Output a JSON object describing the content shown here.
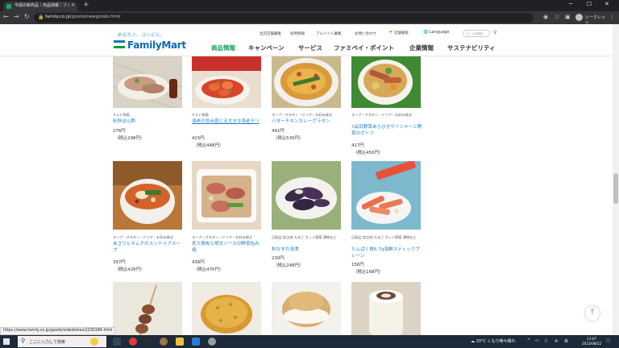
{
  "browser": {
    "tab_title": "今週の新商品｜商品情報｜ファミ",
    "url_host": "family.co.jp",
    "url_path": "/goods/newgoods.html",
    "incognito_label": "シークレット"
  },
  "header": {
    "tagline": "あなたと、コンビに、",
    "logo_text": "FamilyMart",
    "util_links": [
      "出店店舗募集",
      "採用情報",
      "アルバイト募集",
      "お問い合わせ"
    ],
    "store_search": "店舗検索",
    "language": "Language",
    "search_placeholder": "サイト内検索",
    "gnav": [
      "商品情報",
      "キャンペーン",
      "サービス",
      "ファミペイ・ポイント",
      "企業情報",
      "サステナビリティ"
    ]
  },
  "products": [
    {
      "category": "チルド惣菜",
      "name": "砂肝ぽん酢",
      "price": "276円",
      "tax_price": "（税込298円）"
    },
    {
      "category": "チルド惣菜",
      "name": "海老の旨み感じる大きな海老チリ",
      "price": "415円",
      "tax_price": "（税込448円）"
    },
    {
      "category": "スープ・グラタン・ドリア・お好み焼き",
      "name": "バターチキンカレーグラタン",
      "price": "491円",
      "tax_price": "（税込530円）"
    },
    {
      "category": "スープ・グラタン・ドリア・お好み焼き",
      "name": "7品目野菜あらびきウインナーと野菜のポトフ",
      "price": "417円",
      "tax_price": "（税込450円）"
    },
    {
      "category": "スープ・グラタン・ドリア・お好み焼き",
      "name": "あさりとキムチのスンドゥブスープ",
      "price": "397円",
      "tax_price": "（税込428円）"
    },
    {
      "category": "スープ・グラタン・ドリア・お好み焼き",
      "name": "炙り豚肉と明太ソースの野菜包み焼",
      "price": "436円",
      "tax_price": "（税込470円）"
    },
    {
      "category": "日配品 加工肉 たまご カット野菜 漬物など",
      "name": "秋なすの浅漬",
      "price": "230円",
      "tax_price": "（税込248円）"
    },
    {
      "category": "日配品 加工肉 たまご カット野菜 漬物など",
      "name": "たんぱく質6.7g海鮮スティックプレーン",
      "price": "156円",
      "tax_price": "（税込168円）"
    }
  ],
  "status_url": "https://www.family.co.jp/goods/sidedishes/2230184.html",
  "taskbar": {
    "search_placeholder": "ここに入力して検索",
    "weather": "33°C くもり時々晴れ",
    "time": "13:07",
    "date": "2023/08/22"
  }
}
